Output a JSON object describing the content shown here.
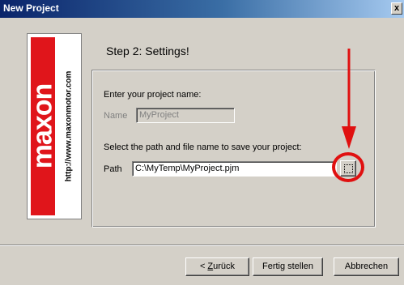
{
  "window": {
    "title": "New Project",
    "close_label": "x"
  },
  "logo": {
    "brand": "maxon",
    "url": "http://www.maxonmotor.com"
  },
  "step_title": "Step 2: Settings!",
  "project": {
    "prompt": "Enter your project name:",
    "name_label": "Name",
    "name_value": "MyProject"
  },
  "path": {
    "prompt": "Select the path and file name to save your project:",
    "path_label": "Path",
    "path_value": "C:\\MyTemp\\MyProject.pjm"
  },
  "buttons": {
    "back_prefix": "< ",
    "back_mnemonic": "Z",
    "back_rest": "urück",
    "finish": "Fertig stellen",
    "cancel": "Abbrechen"
  },
  "colors": {
    "annotation": "#e01010",
    "logo_red": "#e0151b",
    "titlebar": "#0a246a"
  },
  "icons": {
    "browse": "browse-ellipsis-icon",
    "annotation_arrow": "down-arrow-annotation"
  }
}
